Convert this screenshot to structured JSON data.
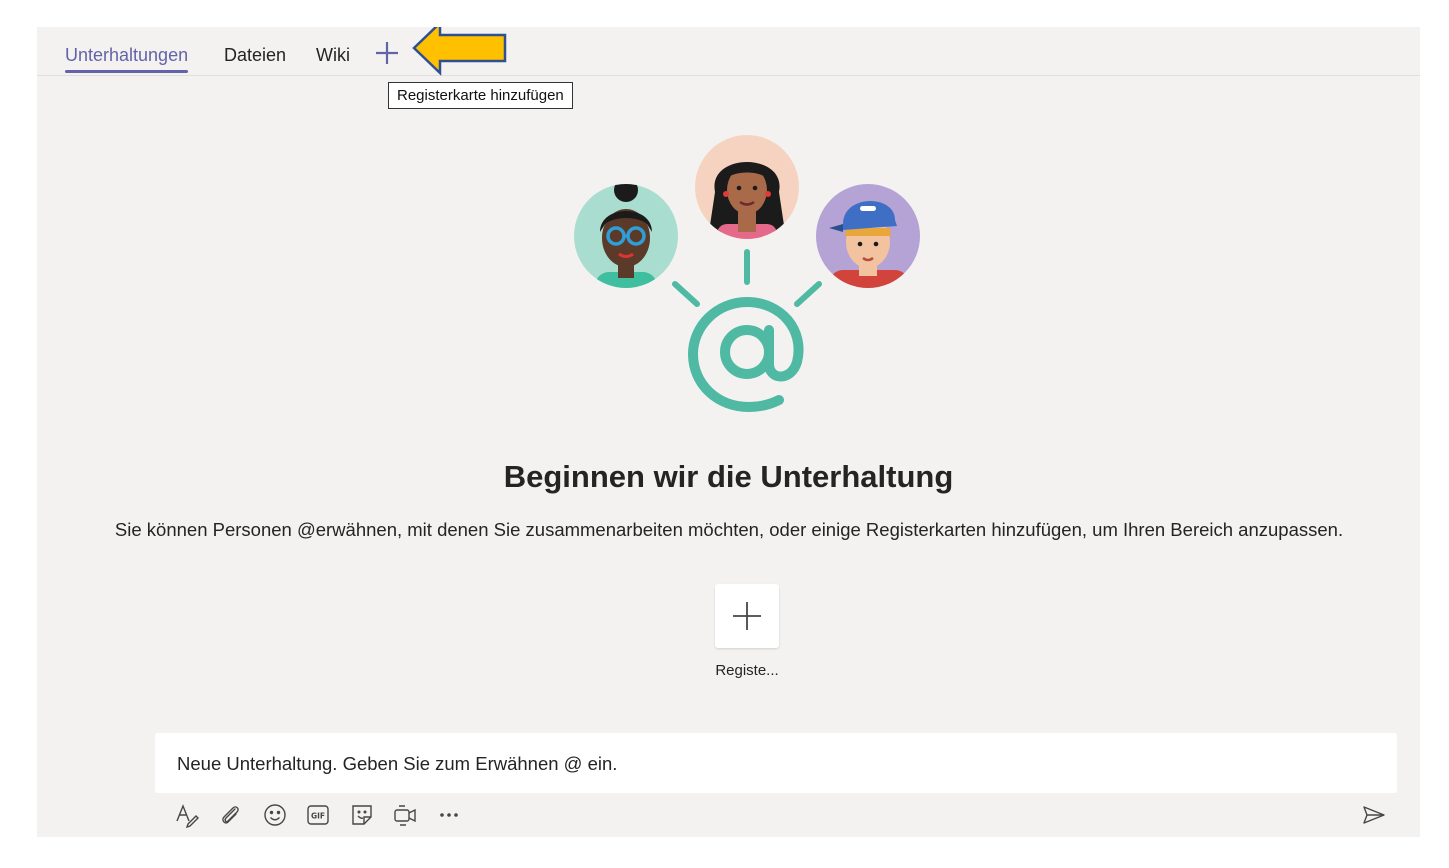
{
  "tabs": [
    {
      "label": "Unterhaltungen",
      "active": true
    },
    {
      "label": "Dateien",
      "active": false
    },
    {
      "label": "Wiki",
      "active": false
    }
  ],
  "tooltip": "Registerkarte hinzufügen",
  "empty_state": {
    "heading": "Beginnen wir die Unterhaltung",
    "description": "Sie können Personen @erwähnen, mit denen Sie zusammenarbeiten möchten, oder einige Registerkarten hinzufügen, um Ihren Bereich anzupassen.",
    "add_tab_card_label": "Registe..."
  },
  "compose": {
    "placeholder": "Neue Unterhaltung. Geben Sie zum Erwähnen @ ein."
  },
  "toolbar_icons": [
    "format-icon",
    "attach-icon",
    "emoji-icon",
    "gif-icon",
    "sticker-icon",
    "meet-now-icon",
    "more-options-icon",
    "send-icon"
  ],
  "colors": {
    "accent": "#6264a7",
    "arrow_fill": "#ffc000",
    "arrow_outline": "#2f528f",
    "at_symbol": "#4fb9a4",
    "background": "#f3f2f1"
  }
}
